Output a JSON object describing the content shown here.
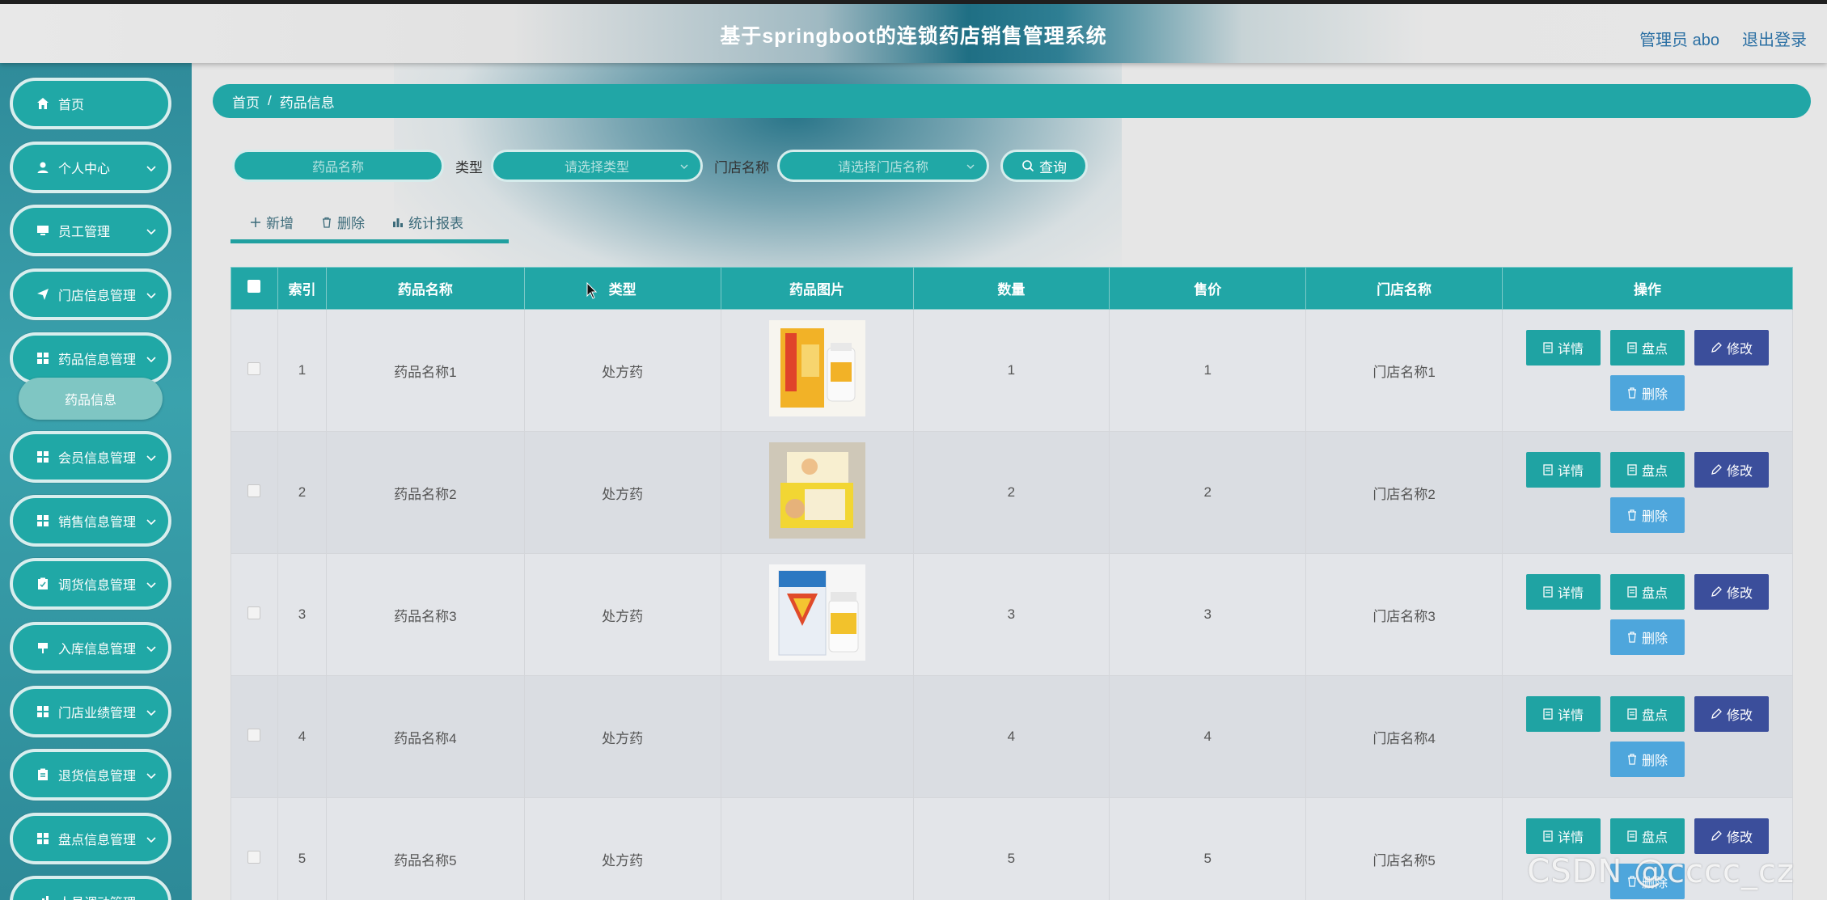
{
  "header": {
    "title": "基于springboot的连锁药店销售管理系统",
    "user_label": "管理员 abo",
    "logout_label": "退出登录"
  },
  "sidebar": {
    "items": [
      {
        "label": "首页",
        "icon": "home-icon",
        "has_children": false
      },
      {
        "label": "个人中心",
        "icon": "user-icon",
        "has_children": true
      },
      {
        "label": "员工管理",
        "icon": "monitor-icon",
        "has_children": true
      },
      {
        "label": "门店信息管理",
        "icon": "send-icon",
        "has_children": true
      },
      {
        "label": "药品信息管理",
        "icon": "grid-icon",
        "has_children": true
      },
      {
        "label": "会员信息管理",
        "icon": "grid-icon",
        "has_children": true
      },
      {
        "label": "销售信息管理",
        "icon": "grid-icon",
        "has_children": true
      },
      {
        "label": "调货信息管理",
        "icon": "clipboard-icon",
        "has_children": true
      },
      {
        "label": "入库信息管理",
        "icon": "flag-icon",
        "has_children": true
      },
      {
        "label": "门店业绩管理",
        "icon": "grid-icon",
        "has_children": true
      },
      {
        "label": "退货信息管理",
        "icon": "clipboard-icon",
        "has_children": true
      },
      {
        "label": "盘点信息管理",
        "icon": "grid-icon",
        "has_children": true
      },
      {
        "label": "人员调动管理",
        "icon": "chart-icon",
        "has_children": true
      }
    ],
    "active_subitem": "药品信息"
  },
  "breadcrumb": {
    "home": "首页",
    "separator": "/",
    "current": "药品信息"
  },
  "search": {
    "name_placeholder": "药品名称",
    "type_label": "类型",
    "type_placeholder": "请选择类型",
    "store_label": "门店名称",
    "store_placeholder": "请选择门店名称",
    "query_label": "查询"
  },
  "actions": {
    "add": "新增",
    "delete": "删除",
    "report": "统计报表"
  },
  "table": {
    "headers": [
      "索引",
      "药品名称",
      "类型",
      "药品图片",
      "数量",
      "售价",
      "门店名称",
      "操作"
    ],
    "rows": [
      {
        "index": "1",
        "name": "药品名称1",
        "type": "处方药",
        "image": "medicine-box-yellow",
        "qty": "1",
        "price": "1",
        "store": "门店名称1"
      },
      {
        "index": "2",
        "name": "药品名称2",
        "type": "处方药",
        "image": "medicine-box-yellow-2",
        "qty": "2",
        "price": "2",
        "store": "门店名称2"
      },
      {
        "index": "3",
        "name": "药品名称3",
        "type": "处方药",
        "image": "medicine-bottle-white",
        "qty": "3",
        "price": "3",
        "store": "门店名称3"
      },
      {
        "index": "4",
        "name": "药品名称4",
        "type": "处方药",
        "image": "",
        "qty": "4",
        "price": "4",
        "store": "门店名称4"
      },
      {
        "index": "5",
        "name": "药品名称5",
        "type": "处方药",
        "image": "",
        "qty": "5",
        "price": "5",
        "store": "门店名称5"
      }
    ],
    "ops": {
      "detail": "详情",
      "check": "盘点",
      "edit": "修改",
      "delete": "删除"
    }
  },
  "watermark": "CSDN @cccc_cz",
  "colors": {
    "teal": "#21a6a6",
    "edit": "#3b4e9b",
    "delete": "#4ea6dc",
    "link": "#2a6fa3"
  }
}
